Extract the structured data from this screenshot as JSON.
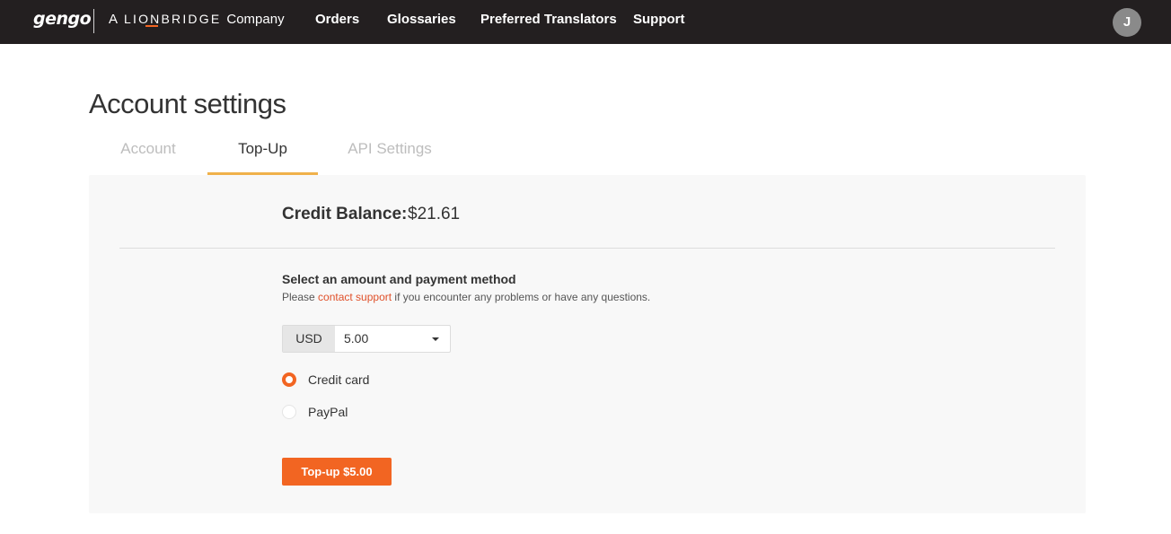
{
  "header": {
    "logo_text": "gengo",
    "brand_prefix": "A",
    "brand_name": "LIONBRIDGE",
    "brand_suffix": "Company",
    "nav": [
      {
        "label": "Orders"
      },
      {
        "label": "Glossaries"
      },
      {
        "label": "Preferred Translators"
      },
      {
        "label": "Support"
      }
    ],
    "avatar_initial": "J"
  },
  "page": {
    "title": "Account settings",
    "tabs": [
      {
        "label": "Account",
        "active": false
      },
      {
        "label": "Top-Up",
        "active": true
      },
      {
        "label": "API Settings",
        "active": false
      }
    ]
  },
  "topup": {
    "balance_label": "Credit Balance:",
    "balance_value": "$21.61",
    "section_title": "Select an amount and payment method",
    "note_before": "Please ",
    "note_link": "contact support",
    "note_after": " if you encounter any problems or have any questions.",
    "currency": "USD",
    "amount": "5.00",
    "payment_methods": [
      {
        "label": "Credit card",
        "selected": true
      },
      {
        "label": "PayPal",
        "selected": false
      }
    ],
    "submit_label": "Top-up $5.00"
  },
  "colors": {
    "accent": "#f26522",
    "tab_underline": "#f0b14a",
    "topbar": "#231f20",
    "link": "#e0502a"
  }
}
